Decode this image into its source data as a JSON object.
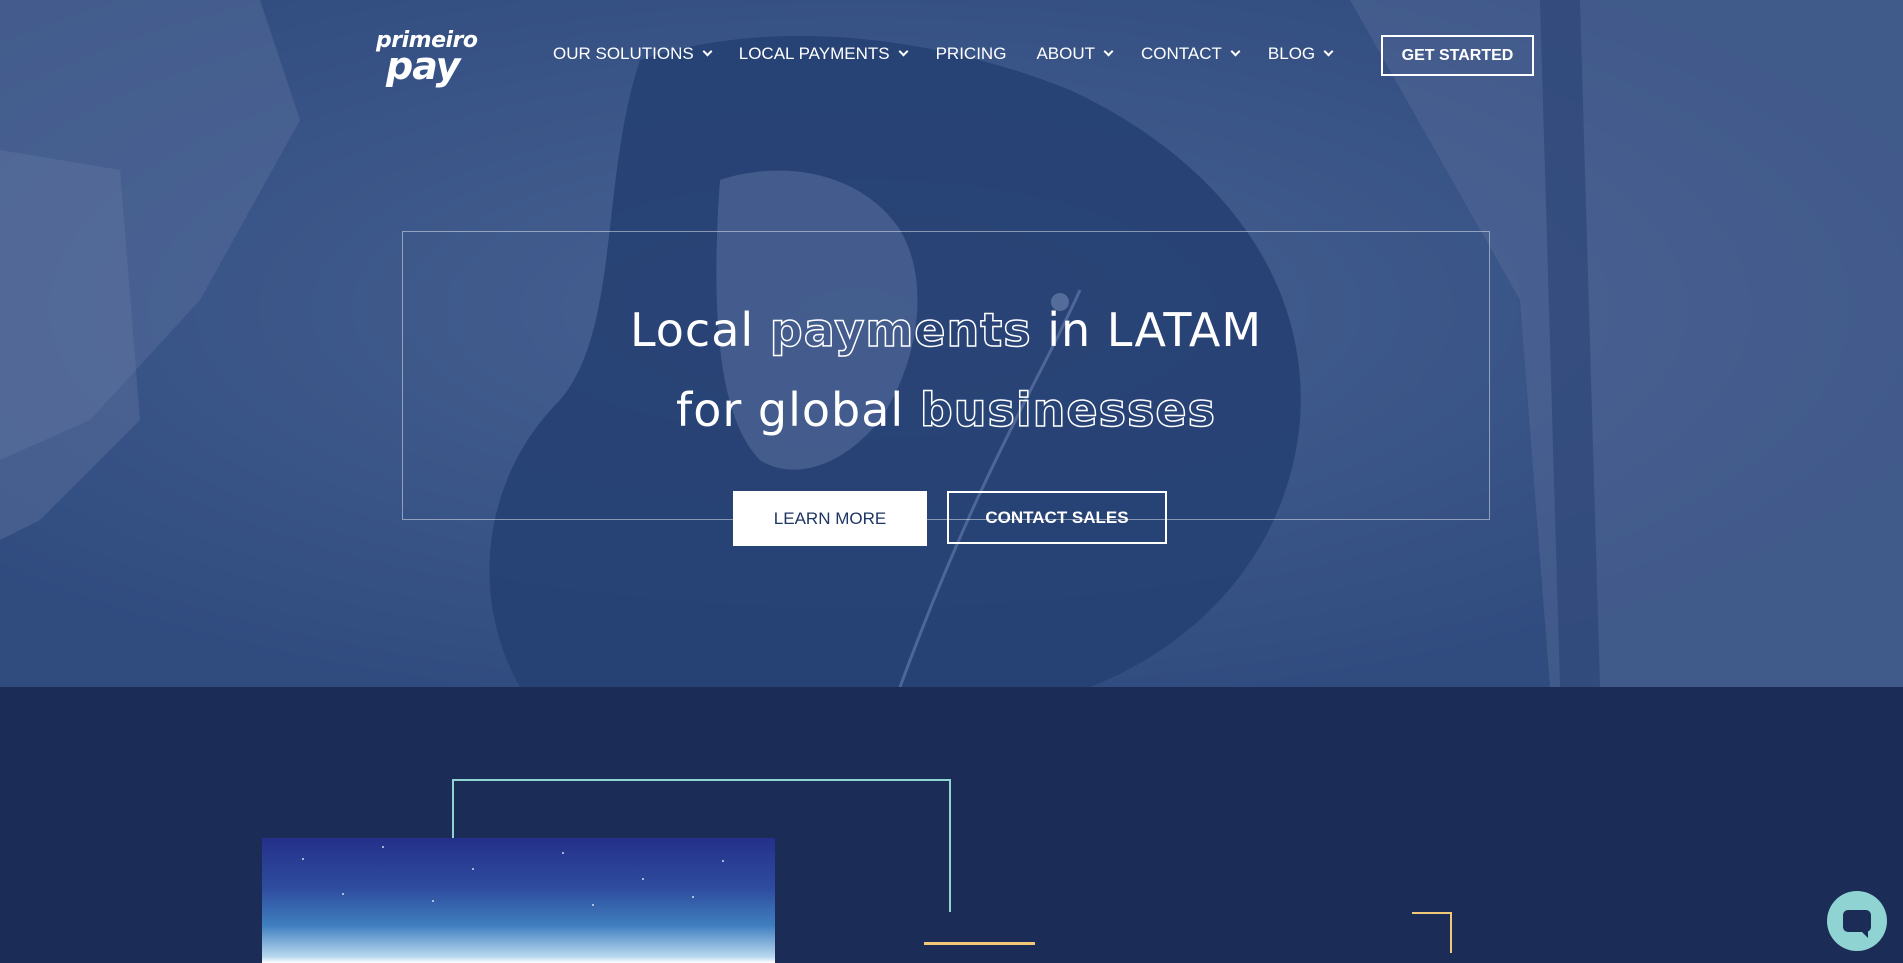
{
  "brand": {
    "logo_top": "primeiro",
    "logo_bottom": "pay"
  },
  "nav": {
    "items": [
      {
        "label": "OUR SOLUTIONS",
        "has_dropdown": true
      },
      {
        "label": "LOCAL PAYMENTS",
        "has_dropdown": true
      },
      {
        "label": "PRICING",
        "has_dropdown": false
      },
      {
        "label": "ABOUT",
        "has_dropdown": true
      },
      {
        "label": "CONTACT",
        "has_dropdown": true
      },
      {
        "label": "BLOG",
        "has_dropdown": true
      }
    ],
    "cta_label": "GET STARTED"
  },
  "hero": {
    "line1_a": "Local ",
    "line1_b": "payments",
    "line1_c": " in LATAM",
    "line2_a": "for global ",
    "line2_b": "businesses",
    "learn_more": "LEARN MORE",
    "contact_sales": "CONTACT SALES"
  },
  "colors": {
    "navy": "#1b2d56",
    "hero_overlay": "#2d4a82",
    "teal": "#8fd4d3",
    "gold": "#f1c877"
  },
  "icons": {
    "chat": "chat-bubble-icon",
    "dropdown": "chevron-down-icon"
  }
}
